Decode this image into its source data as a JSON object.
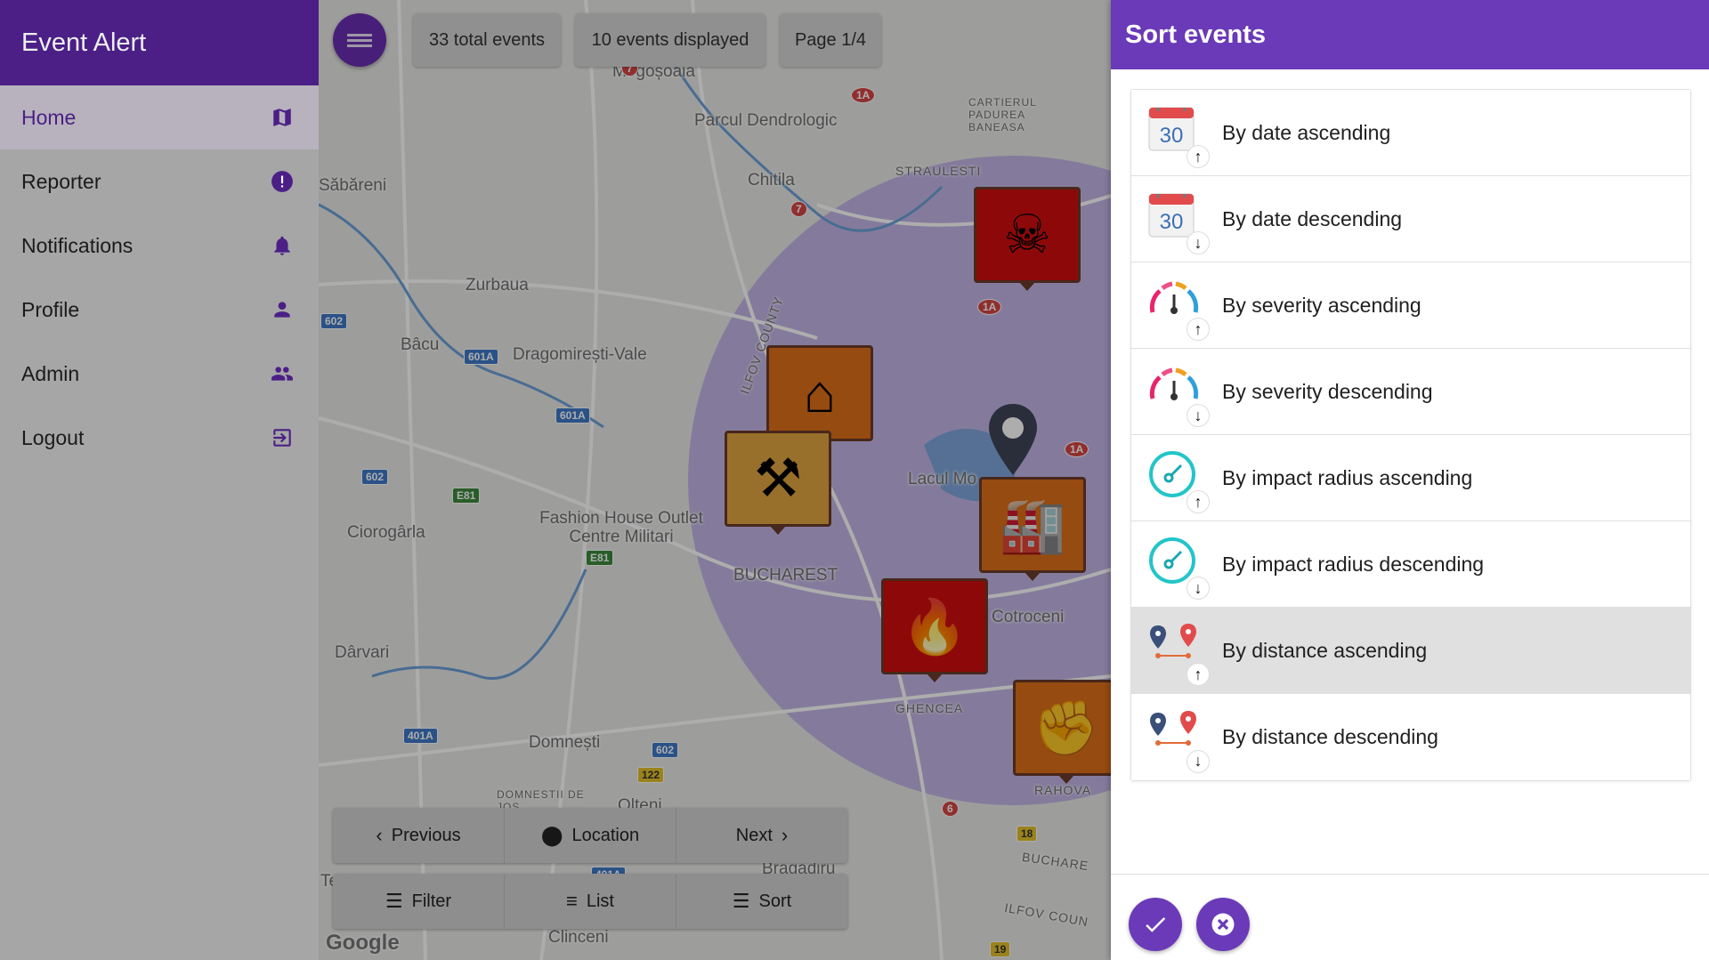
{
  "app": {
    "title": "Event Alert"
  },
  "sidebar": {
    "items": [
      {
        "label": "Home",
        "icon": "map-icon",
        "active": true
      },
      {
        "label": "Reporter",
        "icon": "alert-circle-icon"
      },
      {
        "label": "Notifications",
        "icon": "bell-icon"
      },
      {
        "label": "Profile",
        "icon": "person-icon"
      },
      {
        "label": "Admin",
        "icon": "group-icon"
      },
      {
        "label": "Logout",
        "icon": "logout-icon"
      }
    ]
  },
  "map": {
    "chips": {
      "total": "33 total events",
      "displayed": "10 events displayed",
      "page": "Page 1/4"
    },
    "toolbar": {
      "previous": "Previous",
      "location": "Location",
      "next": "Next",
      "filter": "Filter",
      "list": "List",
      "sort": "Sort"
    },
    "labels": [
      "Mogoșoaia",
      "Parcul Dendrologic",
      "Chitila",
      "Săbăreni",
      "Zurbaua",
      "Bâcu",
      "Dragomirești-Vale",
      "Ciorogârla",
      "Fashion House Outlet Centre Militari",
      "BUCHAREST",
      "Dârvari",
      "Domnești",
      "Olteni",
      "Bragadiru",
      "Clinceni",
      "Cotroceni",
      "ILFOV COUNTY",
      "Lacul Mo",
      "STRAULESTI",
      "CARTIERUL PADUREA BANEASA",
      "GHENCEA",
      "RAHOVA",
      "DOMNESTII DE JOS",
      "Teghes",
      "BUCHARE",
      "ILFOV COUN",
      "Google"
    ],
    "route_shields": [
      "602",
      "601A",
      "601A",
      "602",
      "E81",
      "E81",
      "401A",
      "602",
      "122",
      "401A",
      "1A",
      "7",
      "7",
      "1A",
      "1A",
      "6",
      "18",
      "19"
    ],
    "markers": [
      "gas-mask",
      "flood",
      "break-in",
      "industrial",
      "fire",
      "fist"
    ]
  },
  "sort_panel": {
    "title": "Sort events",
    "options": [
      {
        "label": "By date ascending",
        "icon": "calendar-icon",
        "direction": "up"
      },
      {
        "label": "By date descending",
        "icon": "calendar-icon",
        "direction": "down"
      },
      {
        "label": "By severity ascending",
        "icon": "gauge-icon",
        "direction": "up"
      },
      {
        "label": "By severity descending",
        "icon": "gauge-icon",
        "direction": "down"
      },
      {
        "label": "By impact radius ascending",
        "icon": "radius-icon",
        "direction": "up"
      },
      {
        "label": "By impact radius descending",
        "icon": "radius-icon",
        "direction": "down"
      },
      {
        "label": "By distance ascending",
        "icon": "distance-pins-icon",
        "direction": "up",
        "selected": true
      },
      {
        "label": "By distance descending",
        "icon": "distance-pins-icon",
        "direction": "down"
      }
    ],
    "calendar_day": "30",
    "confirm_icon": "check-icon",
    "cancel_icon": "close-circle-icon"
  },
  "colors": {
    "primary": "#4b1f86",
    "panel_header": "#6a3ab8",
    "selected_row": "#e0e0e0"
  }
}
